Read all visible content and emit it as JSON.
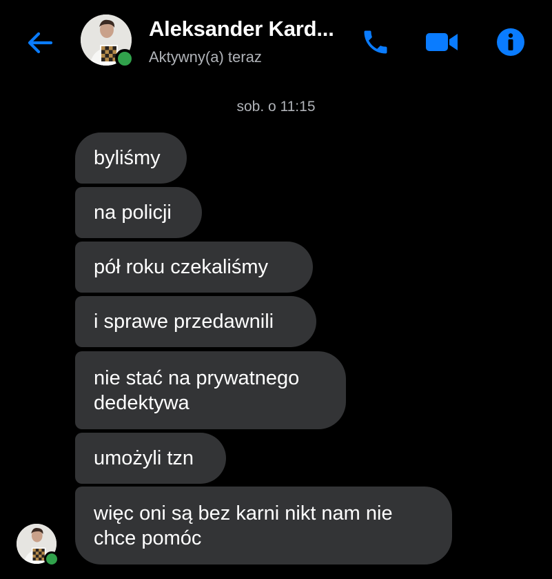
{
  "header": {
    "contact_name": "Aleksander Kard...",
    "status": "Aktywny(a) teraz",
    "back_icon": "arrow-left-icon",
    "call_icon": "phone-icon",
    "video_icon": "video-camera-icon",
    "info_icon": "info-icon"
  },
  "conversation": {
    "timestamp": "sob. o 11:15",
    "messages": [
      {
        "text": "byliśmy"
      },
      {
        "text": "na policji"
      },
      {
        "text": "pół roku czekaliśmy"
      },
      {
        "text": "i sprawe przedawnili"
      },
      {
        "text": "nie stać na prywatnego\ndedektywa"
      },
      {
        "text": "umożyli tzn"
      },
      {
        "text": "więc oni są bez karni nikt nam nie\nchce pomóc"
      }
    ]
  },
  "colors": {
    "background": "#000000",
    "accent": "#0a7cff",
    "bubble": "#333436",
    "secondary_text": "#b0b3b8",
    "presence": "#31a24c"
  }
}
